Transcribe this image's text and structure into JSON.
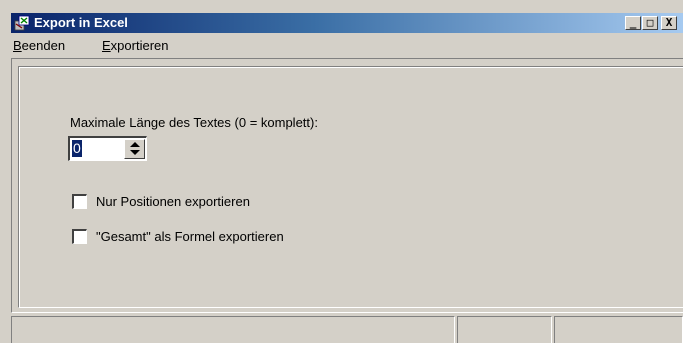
{
  "window": {
    "title": "Export in Excel",
    "controls": {
      "minimize": "_",
      "maximize": "□",
      "close": "X"
    }
  },
  "menu": {
    "items": [
      {
        "label": "Beenden"
      },
      {
        "label": "Exportieren"
      }
    ]
  },
  "form": {
    "max_length_label": "Maximale Länge des Textes (0 = komplett):",
    "max_length_value": "0",
    "checkboxes": [
      {
        "label": "Nur Positionen exportieren",
        "checked": false
      },
      {
        "label": "\"Gesamt\" als Formel exportieren",
        "checked": false
      }
    ]
  },
  "icons": {
    "app": "excel-export-app-icon",
    "spin_up": "arrow-up-icon",
    "spin_down": "arrow-down-icon"
  },
  "colors": {
    "title_bar_start": "#0a246a",
    "title_bar_end": "#a6caf0",
    "window_face": "#d4d0c8",
    "selection": "#0a246a"
  }
}
